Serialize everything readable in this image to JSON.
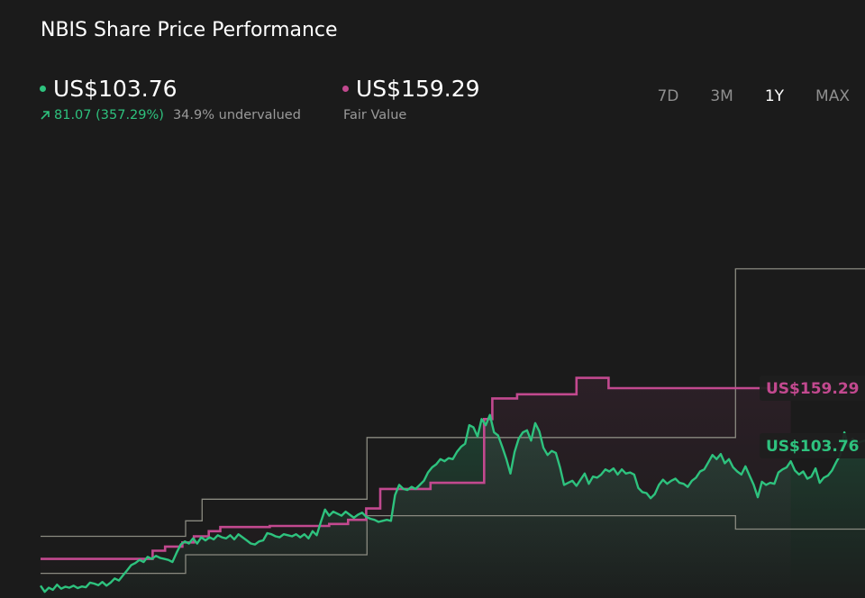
{
  "header": {
    "title": "NBIS Share Price Performance"
  },
  "current": {
    "price": "US$103.76",
    "change": "81.07 (357.29%)",
    "valuation": "34.9% undervalued"
  },
  "fair": {
    "price": "US$159.29",
    "label": "Fair Value"
  },
  "periods": [
    {
      "label": "7D",
      "active": false
    },
    {
      "label": "3M",
      "active": false
    },
    {
      "label": "1Y",
      "active": true
    },
    {
      "label": "MAX",
      "active": false
    }
  ],
  "colors": {
    "background": "#1b1b1b",
    "price_line": "#2ec27e",
    "fair_value_line": "#c2498f",
    "band_line": "#8a8a80",
    "text_muted": "#9a9a9a"
  },
  "chart_data": {
    "type": "line",
    "title": "NBIS Share Price Performance",
    "period": "1Y",
    "grid": false,
    "x_range": [
      0,
      1
    ],
    "y_range": [
      15,
      240
    ],
    "series": [
      {
        "id": "share_price",
        "style": "line-with-area",
        "end_label": "US$103.76",
        "points": [
          [
            0.0,
            21.0
          ],
          [
            0.005,
            18.0
          ],
          [
            0.01,
            20.0
          ],
          [
            0.015,
            19.0
          ],
          [
            0.02,
            21.5
          ],
          [
            0.025,
            19.5
          ],
          [
            0.03,
            20.5
          ],
          [
            0.035,
            20.0
          ],
          [
            0.04,
            21.0
          ],
          [
            0.045,
            19.8
          ],
          [
            0.05,
            20.6
          ],
          [
            0.055,
            20.2
          ],
          [
            0.06,
            22.5
          ],
          [
            0.065,
            22.0
          ],
          [
            0.07,
            21.2
          ],
          [
            0.075,
            22.8
          ],
          [
            0.08,
            21.0
          ],
          [
            0.085,
            22.5
          ],
          [
            0.09,
            24.5
          ],
          [
            0.095,
            23.5
          ],
          [
            0.1,
            26.0
          ],
          [
            0.105,
            28.5
          ],
          [
            0.11,
            31.0
          ],
          [
            0.115,
            32.0
          ],
          [
            0.12,
            33.5
          ],
          [
            0.125,
            32.5
          ],
          [
            0.13,
            35.0
          ],
          [
            0.135,
            34.0
          ],
          [
            0.14,
            35.5
          ],
          [
            0.145,
            34.5
          ],
          [
            0.15,
            34.0
          ],
          [
            0.155,
            33.5
          ],
          [
            0.16,
            32.5
          ],
          [
            0.165,
            37.0
          ],
          [
            0.17,
            41.0
          ],
          [
            0.175,
            42.5
          ],
          [
            0.18,
            41.5
          ],
          [
            0.185,
            44.0
          ],
          [
            0.19,
            41.5
          ],
          [
            0.195,
            44.5
          ],
          [
            0.2,
            43.0
          ],
          [
            0.205,
            44.5
          ],
          [
            0.21,
            43.5
          ],
          [
            0.215,
            45.5
          ],
          [
            0.22,
            44.5
          ],
          [
            0.225,
            44.0
          ],
          [
            0.23,
            45.5
          ],
          [
            0.235,
            43.5
          ],
          [
            0.24,
            46.0
          ],
          [
            0.245,
            44.5
          ],
          [
            0.25,
            43.0
          ],
          [
            0.255,
            41.5
          ],
          [
            0.26,
            41.0
          ],
          [
            0.265,
            42.5
          ],
          [
            0.27,
            43.0
          ],
          [
            0.275,
            46.5
          ],
          [
            0.28,
            46.0
          ],
          [
            0.285,
            45.0
          ],
          [
            0.29,
            44.5
          ],
          [
            0.295,
            46.0
          ],
          [
            0.3,
            45.5
          ],
          [
            0.305,
            45.0
          ],
          [
            0.31,
            46.0
          ],
          [
            0.315,
            44.5
          ],
          [
            0.32,
            46.0
          ],
          [
            0.325,
            44.0
          ],
          [
            0.33,
            47.5
          ],
          [
            0.335,
            45.5
          ],
          [
            0.34,
            52.0
          ],
          [
            0.345,
            58.0
          ],
          [
            0.35,
            55.0
          ],
          [
            0.355,
            57.0
          ],
          [
            0.36,
            56.0
          ],
          [
            0.365,
            55.0
          ],
          [
            0.37,
            57.0
          ],
          [
            0.375,
            55.5
          ],
          [
            0.38,
            54.0
          ],
          [
            0.385,
            55.5
          ],
          [
            0.39,
            56.5
          ],
          [
            0.395,
            54.5
          ],
          [
            0.4,
            53.5
          ],
          [
            0.405,
            53.0
          ],
          [
            0.41,
            52.0
          ],
          [
            0.415,
            52.5
          ],
          [
            0.42,
            53.0
          ],
          [
            0.425,
            52.5
          ],
          [
            0.43,
            65.0
          ],
          [
            0.435,
            70.0
          ],
          [
            0.44,
            68.0
          ],
          [
            0.445,
            67.5
          ],
          [
            0.45,
            69.0
          ],
          [
            0.455,
            68.0
          ],
          [
            0.46,
            70.0
          ],
          [
            0.465,
            72.0
          ],
          [
            0.47,
            76.0
          ],
          [
            0.475,
            78.5
          ],
          [
            0.48,
            80.0
          ],
          [
            0.485,
            82.5
          ],
          [
            0.49,
            81.5
          ],
          [
            0.495,
            83.0
          ],
          [
            0.5,
            82.5
          ],
          [
            0.505,
            86.0
          ],
          [
            0.51,
            88.5
          ],
          [
            0.515,
            90.0
          ],
          [
            0.52,
            99.0
          ],
          [
            0.525,
            98.0
          ],
          [
            0.53,
            93.5
          ],
          [
            0.535,
            102.0
          ],
          [
            0.54,
            99.0
          ],
          [
            0.545,
            104.0
          ],
          [
            0.55,
            95.5
          ],
          [
            0.555,
            94.0
          ],
          [
            0.56,
            88.5
          ],
          [
            0.565,
            82.5
          ],
          [
            0.57,
            75.5
          ],
          [
            0.575,
            86.0
          ],
          [
            0.58,
            92.5
          ],
          [
            0.585,
            95.5
          ],
          [
            0.59,
            96.5
          ],
          [
            0.595,
            91.5
          ],
          [
            0.6,
            100.0
          ],
          [
            0.605,
            96.0
          ],
          [
            0.61,
            88.0
          ],
          [
            0.615,
            84.5
          ],
          [
            0.62,
            86.5
          ],
          [
            0.625,
            85.5
          ],
          [
            0.63,
            78.5
          ],
          [
            0.635,
            70.0
          ],
          [
            0.64,
            71.0
          ],
          [
            0.645,
            72.0
          ],
          [
            0.65,
            69.5
          ],
          [
            0.655,
            72.5
          ],
          [
            0.66,
            75.5
          ],
          [
            0.665,
            70.5
          ],
          [
            0.67,
            74.0
          ],
          [
            0.675,
            73.5
          ],
          [
            0.68,
            75.0
          ],
          [
            0.685,
            77.5
          ],
          [
            0.69,
            76.5
          ],
          [
            0.695,
            78.0
          ],
          [
            0.7,
            75.0
          ],
          [
            0.705,
            77.5
          ],
          [
            0.71,
            75.5
          ],
          [
            0.715,
            76.0
          ],
          [
            0.72,
            75.0
          ],
          [
            0.725,
            68.5
          ],
          [
            0.73,
            66.5
          ],
          [
            0.735,
            66.0
          ],
          [
            0.74,
            63.5
          ],
          [
            0.745,
            65.5
          ],
          [
            0.75,
            70.0
          ],
          [
            0.755,
            72.5
          ],
          [
            0.76,
            70.5
          ],
          [
            0.765,
            72.0
          ],
          [
            0.77,
            73.0
          ],
          [
            0.775,
            71.0
          ],
          [
            0.78,
            70.5
          ],
          [
            0.785,
            69.0
          ],
          [
            0.79,
            72.0
          ],
          [
            0.795,
            73.5
          ],
          [
            0.8,
            76.5
          ],
          [
            0.805,
            77.5
          ],
          [
            0.81,
            81.0
          ],
          [
            0.815,
            84.5
          ],
          [
            0.82,
            82.5
          ],
          [
            0.825,
            85.0
          ],
          [
            0.83,
            80.5
          ],
          [
            0.835,
            82.5
          ],
          [
            0.84,
            78.5
          ],
          [
            0.845,
            76.5
          ],
          [
            0.85,
            75.0
          ],
          [
            0.855,
            79.0
          ],
          [
            0.86,
            74.5
          ],
          [
            0.865,
            70.0
          ],
          [
            0.87,
            64.0
          ],
          [
            0.875,
            71.5
          ],
          [
            0.88,
            70.0
          ],
          [
            0.885,
            71.0
          ],
          [
            0.89,
            70.5
          ],
          [
            0.895,
            76.0
          ],
          [
            0.9,
            77.5
          ],
          [
            0.905,
            78.5
          ],
          [
            0.91,
            81.5
          ],
          [
            0.915,
            77.0
          ],
          [
            0.92,
            75.0
          ],
          [
            0.925,
            76.5
          ],
          [
            0.93,
            73.0
          ],
          [
            0.935,
            74.0
          ],
          [
            0.94,
            78.0
          ],
          [
            0.945,
            71.0
          ],
          [
            0.95,
            73.5
          ],
          [
            0.955,
            74.5
          ],
          [
            0.96,
            77.0
          ],
          [
            0.965,
            81.0
          ],
          [
            0.97,
            84.5
          ],
          [
            0.975,
            95.5
          ],
          [
            0.98,
            88.5
          ],
          [
            0.985,
            92.5
          ],
          [
            0.99,
            90.0
          ],
          [
            0.995,
            91.0
          ],
          [
            1.0,
            91.5
          ]
        ]
      },
      {
        "id": "fair_value",
        "style": "step",
        "end_label": "US$159.29",
        "points": [
          [
            0.0,
            34.0
          ],
          [
            0.136,
            34.0
          ],
          [
            0.136,
            38.0
          ],
          [
            0.151,
            38.0
          ],
          [
            0.151,
            40.0
          ],
          [
            0.172,
            40.0
          ],
          [
            0.172,
            42.0
          ],
          [
            0.186,
            42.0
          ],
          [
            0.186,
            45.0
          ],
          [
            0.204,
            45.0
          ],
          [
            0.204,
            47.5
          ],
          [
            0.218,
            47.5
          ],
          [
            0.218,
            49.5
          ],
          [
            0.278,
            49.5
          ],
          [
            0.278,
            50.0
          ],
          [
            0.35,
            50.0
          ],
          [
            0.35,
            51.0
          ],
          [
            0.373,
            51.0
          ],
          [
            0.373,
            53.0
          ],
          [
            0.395,
            53.0
          ],
          [
            0.395,
            58.5
          ],
          [
            0.412,
            58.5
          ],
          [
            0.412,
            68.0
          ],
          [
            0.473,
            68.0
          ],
          [
            0.473,
            71.0
          ],
          [
            0.538,
            71.0
          ],
          [
            0.538,
            102.0
          ],
          [
            0.548,
            102.0
          ],
          [
            0.548,
            112.0
          ],
          [
            0.578,
            112.0
          ],
          [
            0.578,
            114.0
          ],
          [
            0.65,
            114.0
          ],
          [
            0.65,
            122.0
          ],
          [
            0.689,
            122.0
          ],
          [
            0.689,
            117.0
          ],
          [
            0.91,
            117.0
          ]
        ]
      },
      {
        "id": "band_upper",
        "style": "step",
        "points": [
          [
            0.0,
            45.0
          ],
          [
            0.176,
            45.0
          ],
          [
            0.176,
            52.5
          ],
          [
            0.196,
            52.5
          ],
          [
            0.196,
            63.0
          ],
          [
            0.396,
            63.0
          ],
          [
            0.396,
            93.0
          ],
          [
            0.689,
            93.0
          ],
          [
            0.689,
            93.0
          ],
          [
            0.843,
            93.0
          ],
          [
            0.843,
            175.0
          ],
          [
            1.05,
            175.0
          ],
          [
            1.05,
            240.0
          ],
          [
            1.1,
            240.0
          ]
        ]
      },
      {
        "id": "band_lower",
        "style": "step",
        "points": [
          [
            0.0,
            27.0
          ],
          [
            0.176,
            27.0
          ],
          [
            0.176,
            36.0
          ],
          [
            0.396,
            36.0
          ],
          [
            0.396,
            55.0
          ],
          [
            0.843,
            55.0
          ],
          [
            0.843,
            48.5
          ],
          [
            1.1,
            48.5
          ]
        ]
      }
    ]
  }
}
